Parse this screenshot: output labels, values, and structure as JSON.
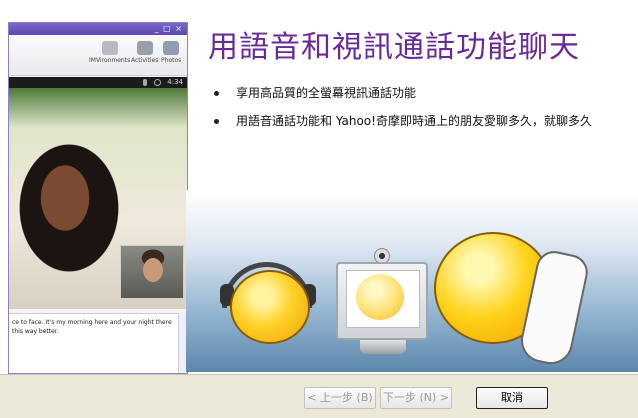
{
  "slide": {
    "headline": "用語音和視訊通話功能聊天",
    "bullets": [
      "享用高品質的全螢幕視訊通話功能",
      "用語音通話功能和 Yahoo!奇摩即時通上的朋友愛聊多久，就聊多久"
    ]
  },
  "messenger_window": {
    "window_buttons": "_ □ ×",
    "toolbar": [
      {
        "label": "IMVironments",
        "icon": "imvironment-icon"
      },
      {
        "label": "Activities",
        "icon": "activities-icon"
      },
      {
        "label": "Photos",
        "icon": "photos-icon"
      }
    ],
    "call_timer": "4:34",
    "chat_text": "ce to face. It's my morning here and your night there this way better."
  },
  "wizard": {
    "back_label": "< 上一步 (B)",
    "next_label": "下一步 (N) >",
    "cancel_label": "取消"
  }
}
